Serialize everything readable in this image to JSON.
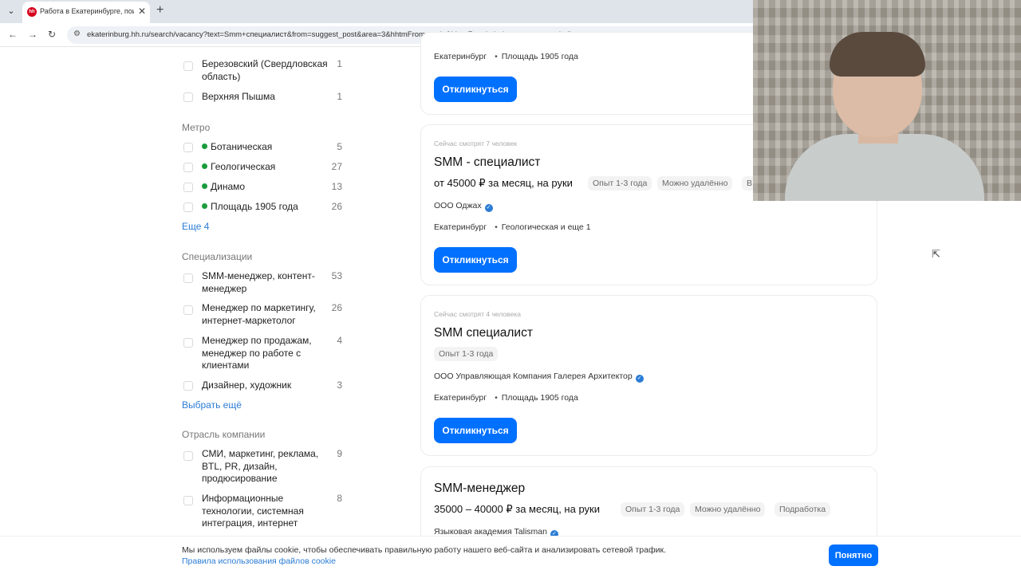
{
  "browser": {
    "tab_title": "Работа в Екатеринбурге, поис",
    "favicon": "hh",
    "url": "ekaterinburg.hh.ru/search/vacancy?text=Smm+специалист&from=suggest_post&area=3&hhtmFrom=main&hhtmFromLabel=vacancy_search_line"
  },
  "filters": {
    "cities": [
      {
        "label": "Березовский (Свердловская область)",
        "count": "1"
      },
      {
        "label": "Верхняя Пышма",
        "count": "1"
      }
    ],
    "metro_heading": "Метро",
    "metro": [
      {
        "label": "Ботаническая",
        "count": "5"
      },
      {
        "label": "Геологическая",
        "count": "27"
      },
      {
        "label": "Динамо",
        "count": "13"
      },
      {
        "label": "Площадь 1905 года",
        "count": "26"
      }
    ],
    "metro_more": "Еще 4",
    "spec_heading": "Специализации",
    "specializations": [
      {
        "label": "SMM-менеджер, контент-менеджер",
        "count": "53"
      },
      {
        "label": "Менеджер по маркетингу, интернет-маркетолог",
        "count": "26"
      },
      {
        "label": "Менеджер по продажам, менеджер по работе с клиентами",
        "count": "4"
      },
      {
        "label": "Дизайнер, художник",
        "count": "3"
      }
    ],
    "spec_more": "Выбрать ещё",
    "industry_heading": "Отрасль компании",
    "industries": [
      {
        "label": "СМИ, маркетинг, реклама, BTL, PR, дизайн, продюсирование",
        "count": "9"
      },
      {
        "label": "Информационные технологии, системная интеграция, интернет",
        "count": "8"
      }
    ]
  },
  "vacancies": [
    {
      "city": "Екатеринбург",
      "metro": "Площадь 1905 года",
      "apply": "Откликнуться"
    },
    {
      "viewers": "Сейчас смотрят 7 человек",
      "title": "SMM - специалист",
      "salary": "от 45000 ₽ за месяц, на руки",
      "tags": [
        "Опыт 1-3 года",
        "Можно удалённо",
        "В"
      ],
      "company": "ООО Оджах",
      "city": "Екатеринбург",
      "metro": "Геологическая и еще 1",
      "apply": "Откликнуться"
    },
    {
      "viewers": "Сейчас смотрят 4 человека",
      "title": "SMM специалист",
      "tags": [
        "Опыт 1-3 года"
      ],
      "company": "ООО Управляющая Компания Галерея Архитектор",
      "city": "Екатеринбург",
      "metro": "Площадь 1905 года",
      "apply": "Откликнуться"
    },
    {
      "title": "SMM-менеджер",
      "salary": "35000 – 40000 ₽ за месяц, на руки",
      "tags": [
        "Опыт 1-3 года",
        "Можно удалённо",
        "Подработка"
      ],
      "company": "Языковая академия Talisman"
    }
  ],
  "cookie": {
    "text": "Мы используем файлы cookie, чтобы обеспечивать правильную работу нашего веб-сайта и анализировать сетевой трафик.",
    "link": "Правила использования файлов cookie",
    "button": "Понятно"
  },
  "colors": {
    "accent": "#0070ff",
    "link": "#2b7cd6",
    "metro_line": "#1a9b3c",
    "favicon": "#d6001c"
  },
  "icons": [
    "tab-list-icon",
    "close-icon",
    "new-tab-icon",
    "back-icon",
    "forward-icon",
    "reload-icon",
    "site-settings-icon",
    "verified-icon",
    "cursor-icon"
  ]
}
